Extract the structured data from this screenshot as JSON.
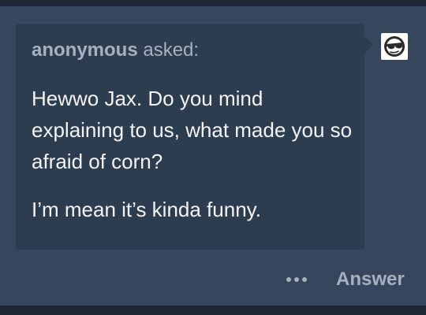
{
  "ask": {
    "asker_name": "anonymous",
    "asker_suffix": " asked:",
    "question_line_1": "Hewwo Jax. Do you mind explaining to us, what made you so afraid of corn?",
    "question_line_2": "I’m mean it’s kinda funny."
  },
  "avatar": {
    "icon": "anonymous-sunglasses-icon"
  },
  "actions": {
    "more_icon": "ellipsis-icon",
    "answer_label": "Answer"
  },
  "colors": {
    "background": "#36465d",
    "bubble": "#2d3d50",
    "muted_text": "#a6b1bf",
    "body_text": "#f2f3f5"
  }
}
